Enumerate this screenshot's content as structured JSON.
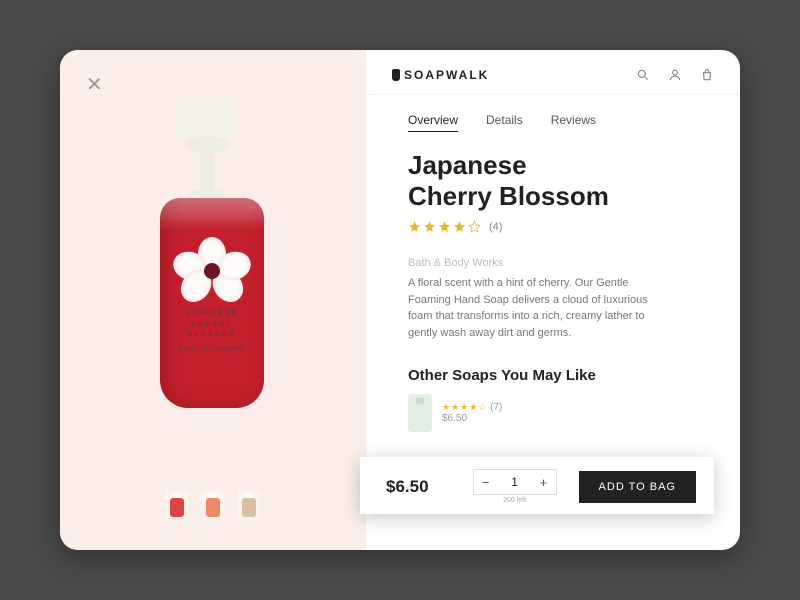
{
  "brand_logo": "SOAPWALK",
  "tabs": {
    "overview": "Overview",
    "details": "Details",
    "reviews": "Reviews"
  },
  "product": {
    "title_line1": "Japanese",
    "title_line2": "Cherry Blossom",
    "rating": 4,
    "rating_count": "(4)",
    "brand": "Bath & Body Works",
    "description": "A floral scent with a hint of cherry. Our Gentle Foaming Hand Soap delivers a cloud of luxurious foam that transforms into a rich, creamy lather to gently wash away dirt and germs.",
    "label_line1": "JAPANESE",
    "label_line2": "CHERRY",
    "label_line3": "BLOSSOM",
    "label_sub": "GENTLE FOAMING"
  },
  "recommendations": {
    "heading": "Other Soaps You May Like",
    "item_rating": "★★★★☆",
    "item_count": "(7)",
    "item_price": "$6.50"
  },
  "buy": {
    "price": "$6.50",
    "qty": "1",
    "stock": "200 left",
    "cta": "ADD TO BAG"
  }
}
